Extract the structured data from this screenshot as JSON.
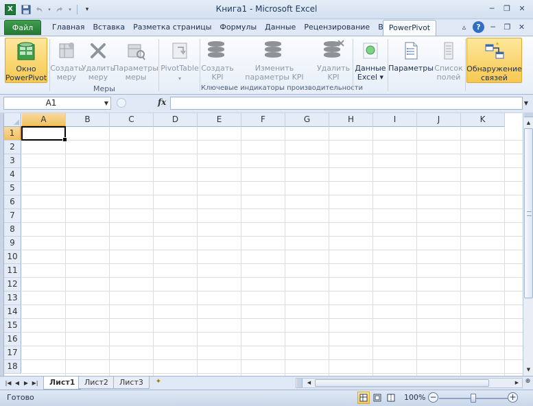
{
  "app": {
    "window_title": "Книга1 - Microsoft Excel",
    "app_icon": "X"
  },
  "quick_access": {
    "icons": [
      "save-icon",
      "undo-icon",
      "redo-icon",
      "customize-qat-icon"
    ]
  },
  "window_controls": {
    "minimize": "─",
    "restore": "❐",
    "close": "✕"
  },
  "ribbon_tabs": {
    "file": "Файл",
    "tabs": [
      "Главная",
      "Вставка",
      "Разметка страницы",
      "Формулы",
      "Данные",
      "Рецензирование",
      "Вид"
    ],
    "active": "PowerPivot",
    "right_icons": [
      "▵",
      "?",
      "─",
      "❐",
      "✕"
    ]
  },
  "ribbon": {
    "buttons": {
      "powerpivot_window": "Окно\nPowerPivot",
      "create_measure": "Создать\nмеру",
      "delete_measure": "Удалить\nмеру",
      "measure_settings": "Параметры\nмеры",
      "pivottable": "PivotTable",
      "pivottable_arrow": "▾",
      "create_kpi": "Создать\nKPI",
      "edit_kpi": "Изменить\nпараметры KPI",
      "delete_kpi": "Удалить\nKPI",
      "excel_data": "Данные\nExcel ▾",
      "settings": "Параметры",
      "field_list": "Список\nполей",
      "detect_relations": "Обнаружение\nсвязей"
    },
    "groups": {
      "measures": "Меры",
      "kpi": "Ключевые индикаторы производительности"
    }
  },
  "formula_bar": {
    "name_box": "A1",
    "fx": "fx",
    "formula": ""
  },
  "grid": {
    "columns": [
      "A",
      "B",
      "C",
      "D",
      "E",
      "F",
      "G",
      "H",
      "I",
      "J",
      "K"
    ],
    "rows": [
      "1",
      "2",
      "3",
      "4",
      "5",
      "6",
      "7",
      "8",
      "9",
      "10",
      "11",
      "12",
      "13",
      "14",
      "15",
      "16",
      "17",
      "18"
    ],
    "active_cell": "A1"
  },
  "sheets": {
    "tabs": [
      "Лист1",
      "Лист2",
      "Лист3"
    ],
    "active": "Лист1"
  },
  "status": {
    "ready": "Готово",
    "zoom": "100%"
  },
  "colors": {
    "file_tab": "#257a34",
    "selected_highlight": "#f7c851",
    "ribbon_border": "#9eb6d3"
  }
}
